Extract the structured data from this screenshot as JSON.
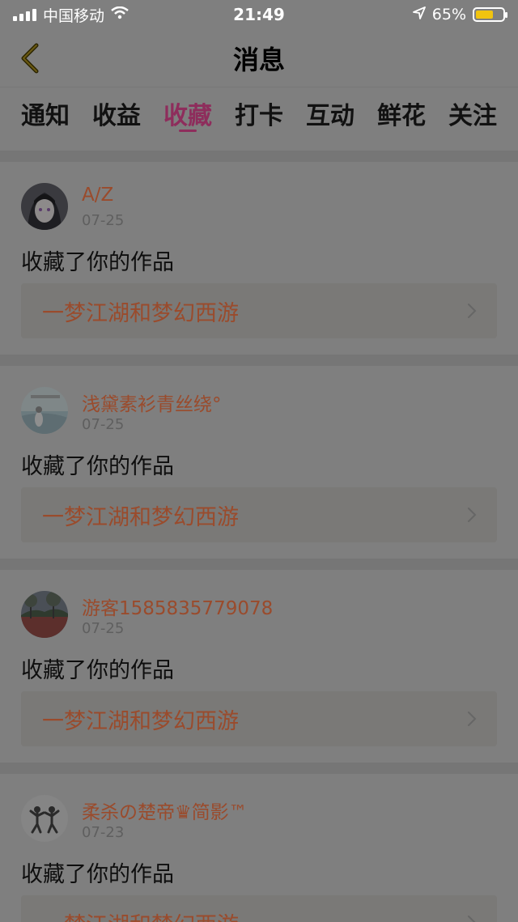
{
  "status_bar": {
    "carrier": "中国移动",
    "time": "21:49",
    "battery_percent": "65%",
    "battery_level": 0.65,
    "icons": [
      "signal-icon",
      "wifi-icon",
      "location-icon",
      "battery-icon"
    ]
  },
  "header": {
    "title": "消息",
    "back_icon": "chevron-left-icon"
  },
  "tabs": [
    {
      "label": "通知"
    },
    {
      "label": "收益"
    },
    {
      "label": "收藏",
      "active": true
    },
    {
      "label": "打卡"
    },
    {
      "label": "互动"
    },
    {
      "label": "鲜花"
    },
    {
      "label": "关注"
    }
  ],
  "messages": [
    {
      "user": "A/Z",
      "date": "07-25",
      "action": "收藏了你的作品",
      "work": "一梦江湖和梦幻西游"
    },
    {
      "user": "浅黛素衫青丝绕°",
      "date": "07-25",
      "action": "收藏了你的作品",
      "work": "一梦江湖和梦幻西游"
    },
    {
      "user": "游客1585835779078",
      "date": "07-25",
      "action": "收藏了你的作品",
      "work": "一梦江湖和梦幻西游"
    },
    {
      "user": "柔杀の楚帝♛简影™",
      "date": "07-23",
      "action": "收藏了你的作品",
      "work": "一梦江湖和梦幻西游"
    }
  ],
  "colors": {
    "accent": "#8e2d5c",
    "username": "#9a4b2c",
    "overlay_bg": "#7f7f7f"
  }
}
